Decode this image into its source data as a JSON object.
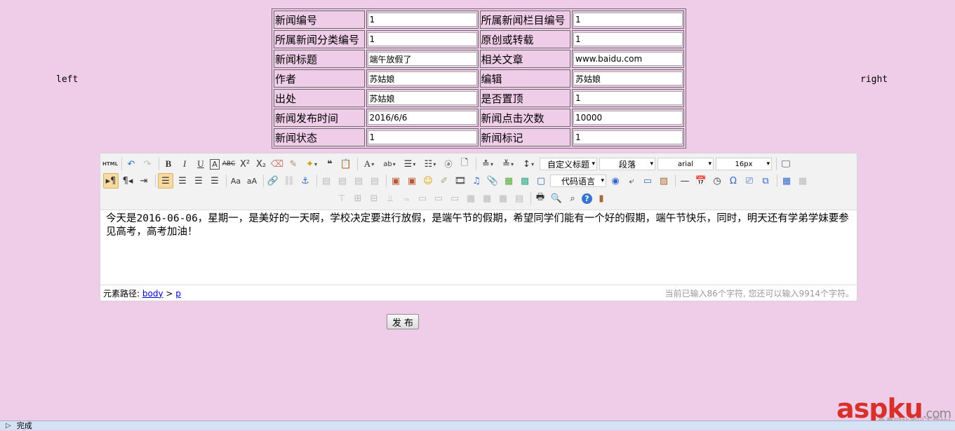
{
  "side": {
    "left": "left",
    "right": "right"
  },
  "form": {
    "rows": [
      {
        "label1": "新闻编号",
        "value1": "1",
        "label2": "所属新闻栏目编号",
        "value2": "1"
      },
      {
        "label1": "所属新闻分类编号",
        "value1": "1",
        "label2": "原创或转载",
        "value2": "1"
      },
      {
        "label1": "新闻标题",
        "value1": "端午放假了",
        "label2": "相关文章",
        "value2": "www.baidu.com"
      },
      {
        "label1": "作者",
        "value1": "苏姑娘",
        "label2": "编辑",
        "value2": "苏姑娘"
      },
      {
        "label1": "出处",
        "value1": "苏姑娘",
        "label2": "是否置顶",
        "value2": "1"
      },
      {
        "label1": "新闻发布时间",
        "value1": "2016/6/6",
        "label2": "新闻点击次数",
        "value2": "10000"
      },
      {
        "label1": "新闻状态",
        "value1": "1",
        "label2": "新闻标记",
        "value2": "1"
      }
    ]
  },
  "editor": {
    "toolbar": {
      "html": "HTML",
      "custom_title": "自定义标题",
      "paragraph": "段落",
      "font": "arial",
      "size": "16px",
      "code_language": "代码语言"
    },
    "content": "今天是2016-06-06，星期一，是美好的一天啊，学校决定要进行放假，是端午节的假期，希望同学们能有一个好的假期，端午节快乐，同时，明天还有学弟学妹要参见高考，高考加油！",
    "path_label": "元素路径:",
    "path_body": "body",
    "path_sep": ">",
    "path_p": "p",
    "counter": "当前已输入86个字符, 您还可以输入9914个字符。"
  },
  "publish_label": "发 布",
  "browser_status": "完成",
  "watermark": {
    "brand": "aspku",
    "suffix": ".com",
    "sub": "免费网站源码下载站!"
  }
}
